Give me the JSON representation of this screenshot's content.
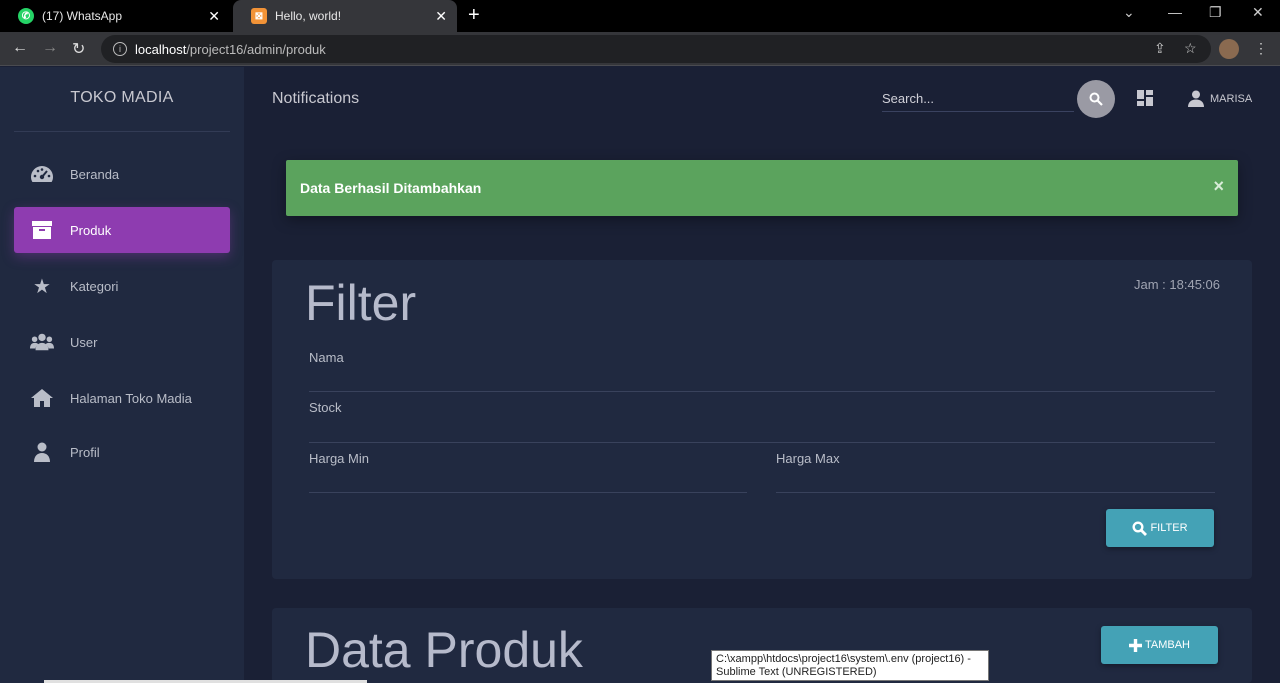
{
  "browser": {
    "tabs": [
      {
        "label": "(17) WhatsApp",
        "icon": "whatsapp-icon"
      },
      {
        "label": "Hello, world!",
        "icon": "xampp-icon"
      }
    ],
    "url_host": "localhost",
    "url_path": "/project16/admin/produk"
  },
  "sidebar": {
    "brand": "TOKO MADIA",
    "items": [
      {
        "label": "Beranda",
        "icon": "dashboard-icon"
      },
      {
        "label": "Produk",
        "icon": "archive-icon",
        "active": true
      },
      {
        "label": "Kategori",
        "icon": "star-icon"
      },
      {
        "label": "User",
        "icon": "users-icon"
      },
      {
        "label": "Halaman Toko Madia",
        "icon": "home-icon"
      },
      {
        "label": "Profil",
        "icon": "person-icon"
      }
    ]
  },
  "topbar": {
    "title": "Notifications",
    "search_placeholder": "Search...",
    "user_name": "MARISA"
  },
  "alert": {
    "message": "Data Berhasil Ditambahkan",
    "close": "×",
    "color": "#5ba35d"
  },
  "filter": {
    "title": "Filter",
    "clock": "Jam : 18:45:06",
    "fields": {
      "nama": "Nama",
      "stock": "Stock",
      "harga_min": "Harga Min",
      "harga_max": "Harga Max"
    },
    "button": "FILTER"
  },
  "data_produk": {
    "title": "Data Produk",
    "button": "TAMBAH"
  },
  "tooltip": {
    "line1": "C:\\xampp\\htdocs\\project16\\system\\.env (project16) -",
    "line2": "Sublime Text (UNREGISTERED)"
  },
  "colors": {
    "accent": "#8e3cb0",
    "button": "#44a2b6",
    "background": "#1a2035",
    "panel": "#202940"
  }
}
